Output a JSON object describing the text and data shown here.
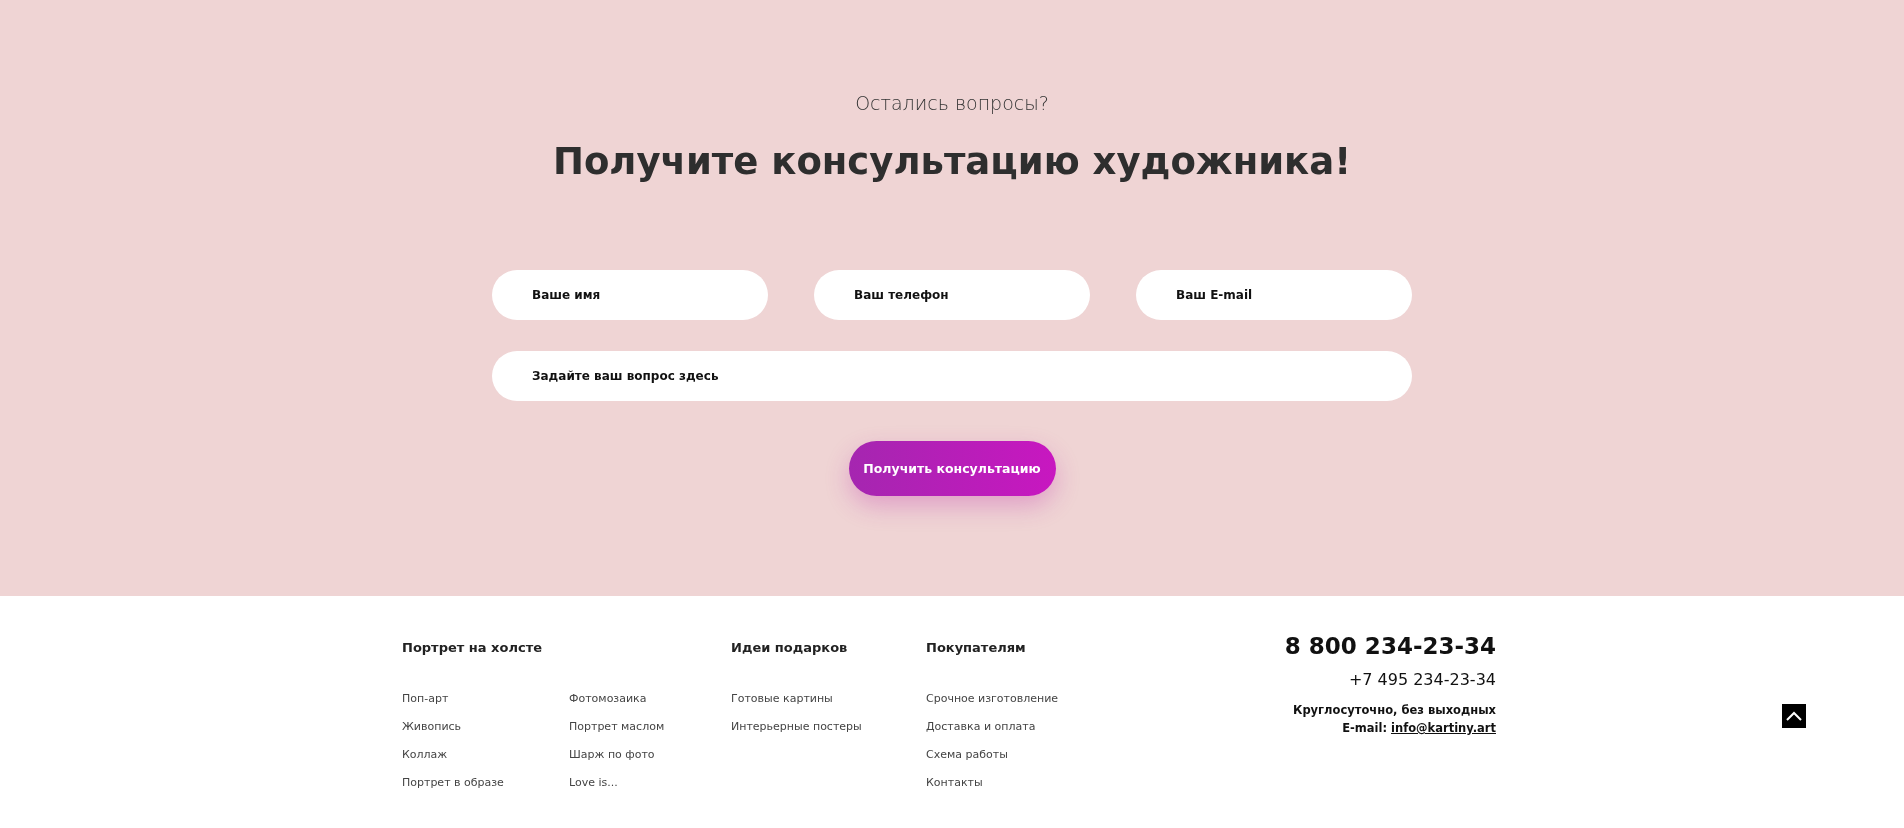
{
  "consultation": {
    "subtitle": "Остались вопросы?",
    "title": "Получите консультацию художника!",
    "fields": [
      {
        "placeholder": "Ваше имя"
      },
      {
        "placeholder": "Ваш телефон"
      },
      {
        "placeholder": "Ваш E-mail"
      }
    ],
    "question": {
      "placeholder": "Задайте ваш вопрос здесь"
    },
    "submit": "Получить консультацию"
  },
  "footer": {
    "columns": [
      {
        "heading": "Портрет на холсте",
        "link_groups": [
          [
            "Поп-арт",
            "Живопись",
            "Коллаж",
            "Портрет в образе"
          ],
          [
            "Фотомозаика",
            "Портрет маслом",
            "Шарж по фото",
            "Love is..."
          ]
        ]
      },
      {
        "heading": "Идеи подарков",
        "link_groups": [
          [
            "Готовые картины",
            "Интерьерные постеры"
          ]
        ]
      },
      {
        "heading": "Покупателям",
        "link_groups": [
          [
            "Срочное изготовление",
            "Доставка и оплата",
            "Схема работы",
            "Контакты"
          ]
        ]
      }
    ],
    "contacts": {
      "phone_main": "8 800 234-23-34",
      "phone_second": "+7 495 234-23-34",
      "hours": "Круглосуточно, без выходных",
      "email_label": "E-mail:",
      "email": "info@kartiny.art"
    }
  }
}
